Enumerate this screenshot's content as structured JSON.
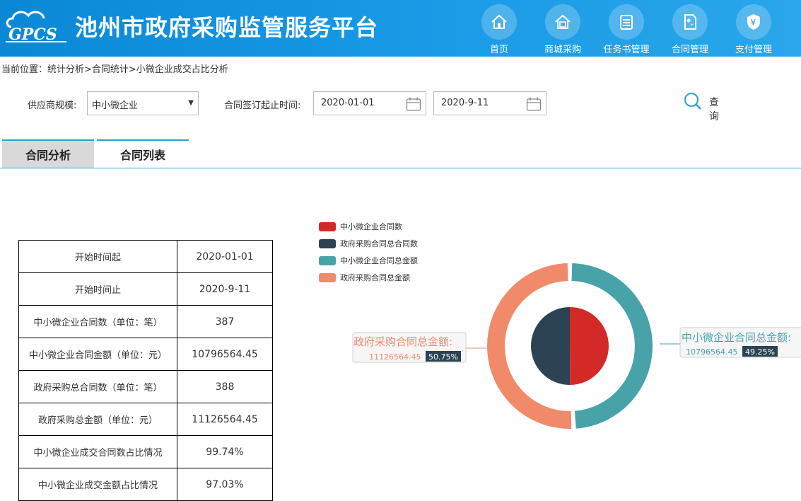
{
  "header": {
    "logo_text": "GPCS",
    "title": "池州市政府采购监管服务平台",
    "nav": [
      {
        "label": "首页",
        "icon": "home-icon"
      },
      {
        "label": "商城采购",
        "icon": "mall-icon"
      },
      {
        "label": "任务书管理",
        "icon": "task-book-icon"
      },
      {
        "label": "合同管理",
        "icon": "contract-icon"
      },
      {
        "label": "支付管理",
        "icon": "payment-icon"
      }
    ]
  },
  "breadcrumb": "当前位置：统计分析>合同统计>小微企业成交占比分析",
  "filters": {
    "supplier_label": "供应商规模:",
    "supplier_value": "中小微企业",
    "date_label": "合同签订起止时间:",
    "start_date": "2020-01-01",
    "end_date": "2020-9-11",
    "query_label": "查询"
  },
  "tabs": [
    {
      "label": "合同分析",
      "active": true
    },
    {
      "label": "合同列表",
      "active": false
    }
  ],
  "stats_table": [
    {
      "key": "开始时间起",
      "value": "2020-01-01"
    },
    {
      "key": "开始时间止",
      "value": "2020-9-11"
    },
    {
      "key": "中小微企业合同数（单位：笔）",
      "value": "387"
    },
    {
      "key": "中小微企业合同金额（单位：元）",
      "value": "10796564.45"
    },
    {
      "key": "政府采购总合同数（单位：笔）",
      "value": "388"
    },
    {
      "key": "政府采购总金额（单位：元）",
      "value": "11126564.45"
    },
    {
      "key": "中小微企业成交合同数占比情况",
      "value": "99.74%"
    },
    {
      "key": "中小微企业成交金额占比情况",
      "value": "97.03%"
    }
  ],
  "colors": {
    "header_blue": "#0a88d6",
    "sme_count": "#d42a27",
    "gov_count": "#2b4352",
    "sme_amount": "#48a3a9",
    "gov_amount": "#f08a6b",
    "accent": "#2a9fd6"
  },
  "chart_data": {
    "type": "pie",
    "legend_position": "top-left",
    "legend": [
      "中小微企业合同数",
      "政府采购合同总合同数",
      "中小微企业合同总金额",
      "政府采购合同总金额"
    ],
    "inner_ring": [
      {
        "name": "中小微企业合同数",
        "value": 387
      },
      {
        "name": "政府采购合同总合同数",
        "value": 388
      }
    ],
    "outer_ring": [
      {
        "name": "中小微企业合同总金额",
        "value": 10796564.45,
        "percent": "49.25%"
      },
      {
        "name": "政府采购合同总金额",
        "value": 11126564.45,
        "percent": "50.75%"
      }
    ],
    "labels": [
      {
        "title": "中小微企业合同总金额:",
        "value": "10796564.45",
        "percent": "49.25%"
      },
      {
        "title": "政府采购合同总金额:",
        "value": "11126564.45",
        "percent": "50.75%"
      }
    ]
  }
}
